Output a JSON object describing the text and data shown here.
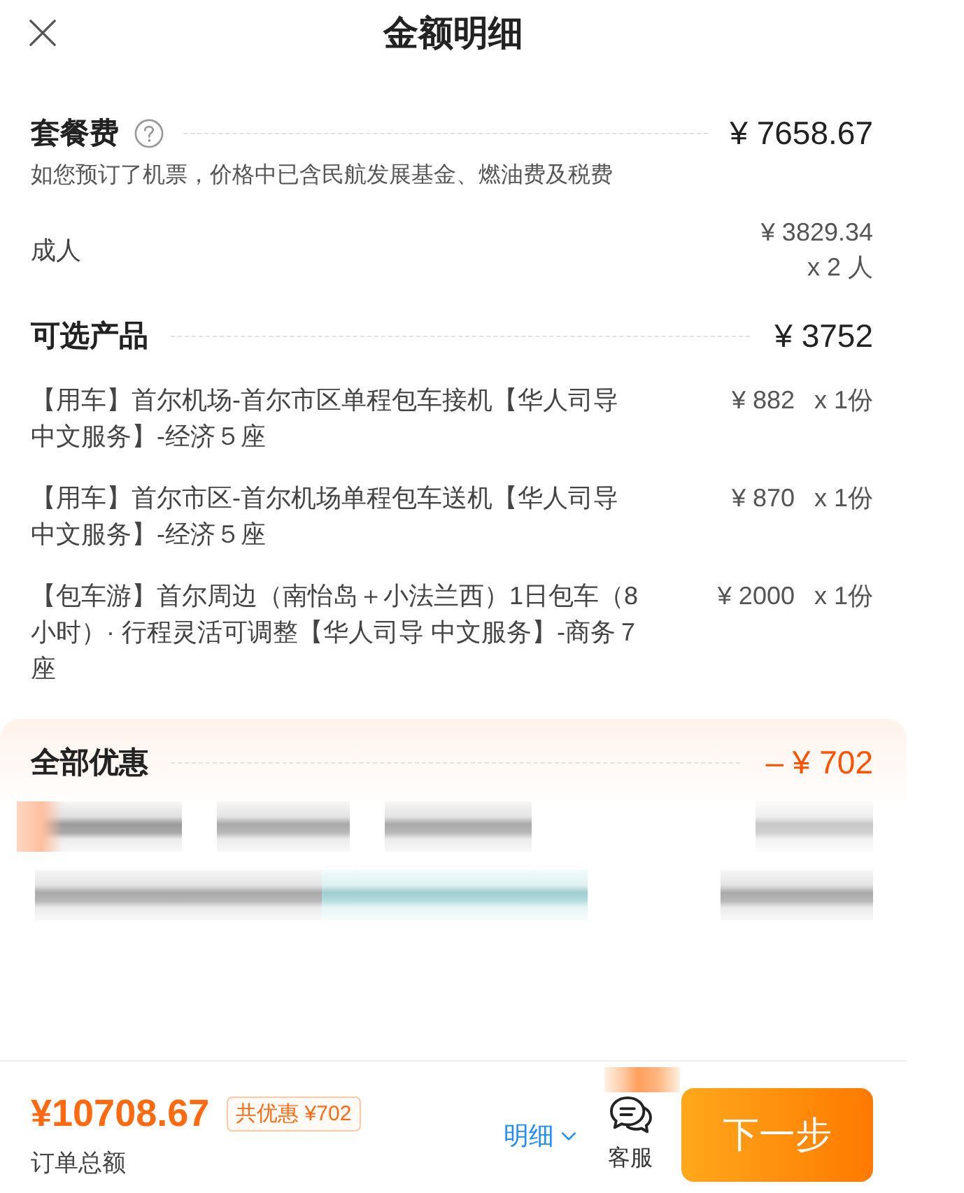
{
  "header": {
    "title": "金额明细"
  },
  "package_fee": {
    "label": "套餐费",
    "amount": "¥ 7658.67",
    "note": "如您预订了机票，价格中已含民航发展基金、燃油费及税费",
    "rows": [
      {
        "label": "成人",
        "price": "¥ 3829.34",
        "quantity": "x 2 人"
      }
    ]
  },
  "optional_products": {
    "label": "可选产品",
    "amount": "¥ 3752",
    "items": [
      {
        "name": "【用车】首尔机场-首尔市区单程包车接机【华人司导中文服务】-经济５座",
        "price": "¥ 882",
        "quantity": "x 1份"
      },
      {
        "name": "【用车】首尔市区-首尔机场单程包车送机【华人司导中文服务】-经济５座",
        "price": "¥ 870",
        "quantity": "x 1份"
      },
      {
        "name": "【包车游】首尔周边（南怡岛＋小法兰西）1日包车（8小时）· 行程灵活可调整【华人司导 中文服务】-商务７座",
        "price": "¥ 2000",
        "quantity": "x 1份"
      }
    ]
  },
  "discounts": {
    "label": "全部优惠",
    "amount": "– ¥ 702"
  },
  "footer": {
    "total": "¥10708.67",
    "savings_badge": "共优惠 ¥702",
    "total_label": "订单总额",
    "details_link": "明细",
    "service_label": "客服",
    "next_button": "下一步"
  }
}
